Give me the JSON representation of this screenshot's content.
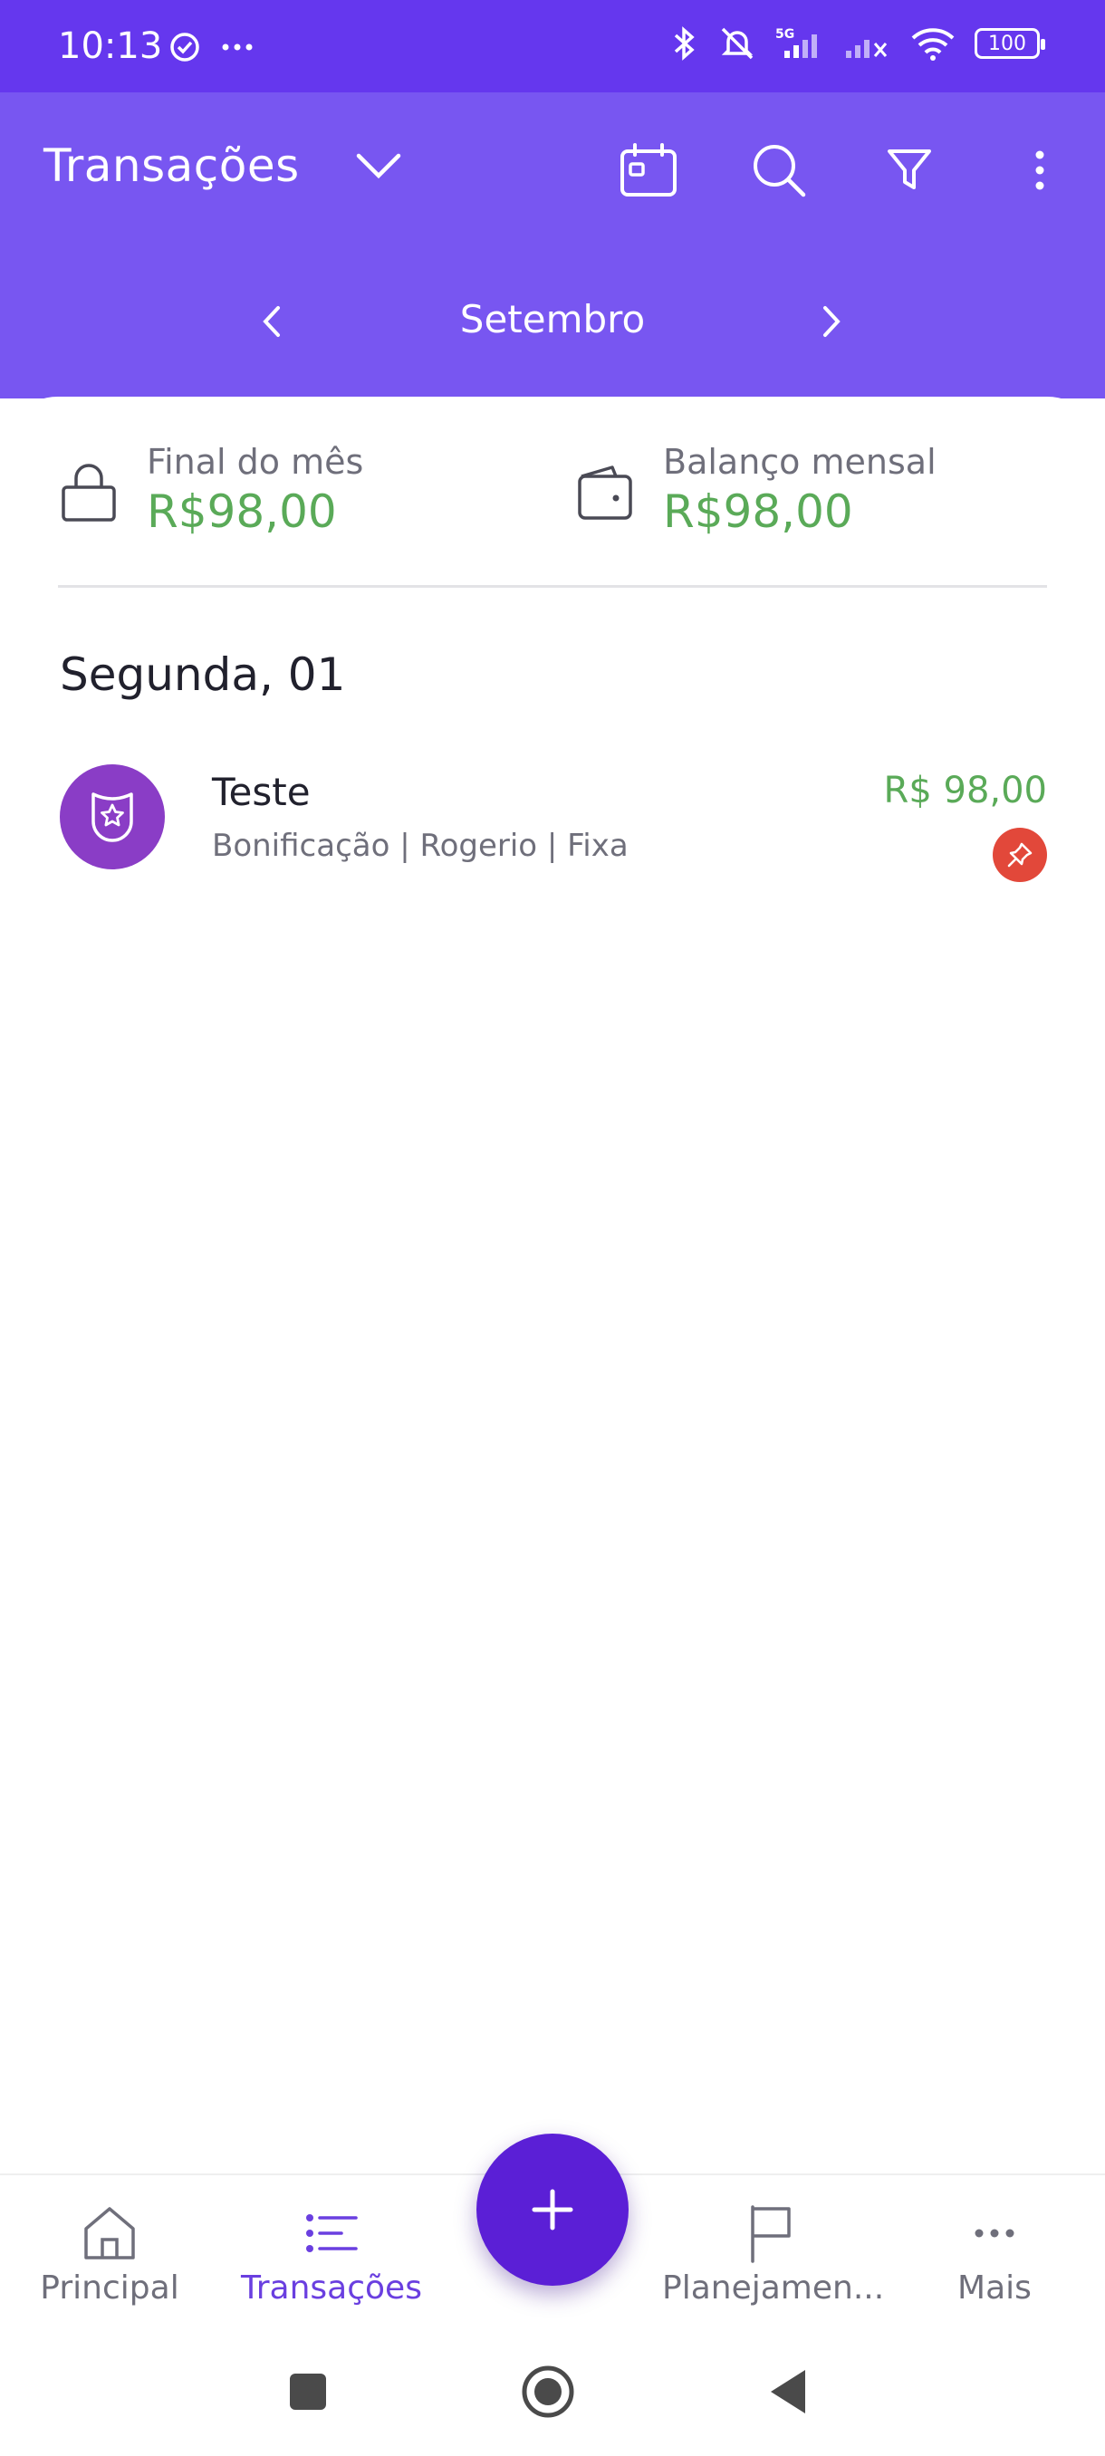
{
  "status_bar": {
    "time": "10:13",
    "battery": "100",
    "network": "5G"
  },
  "header": {
    "title": "Transações",
    "month": "Setembro"
  },
  "summary": {
    "end_of_month": {
      "label": "Final do mês",
      "value": "R$98,00"
    },
    "monthly_balance": {
      "label": "Balanço mensal",
      "value": "R$98,00"
    }
  },
  "day": {
    "header": "Segunda, 01",
    "transactions": [
      {
        "title": "Teste",
        "subtitle": "Bonificação | Rogerio  | Fixa",
        "amount": "R$ 98,00",
        "icon": "badge-star-icon",
        "pinned_icon": "pin-icon"
      }
    ]
  },
  "bottom_nav": {
    "items": [
      {
        "label": "Principal",
        "icon": "home-icon"
      },
      {
        "label": "Transações",
        "icon": "list-icon",
        "active": true
      },
      {
        "label": "Planejamen...",
        "icon": "flag-icon"
      },
      {
        "label": "Mais",
        "icon": "more-horizontal-icon"
      }
    ],
    "fab_icon": "plus-icon"
  },
  "colors": {
    "primary": "#7856f1",
    "status_bar": "#6537ee",
    "fab": "#5b1fd6",
    "positive": "#5aaa58",
    "pin": "#e2483a",
    "avatar": "#8a3dc6"
  }
}
